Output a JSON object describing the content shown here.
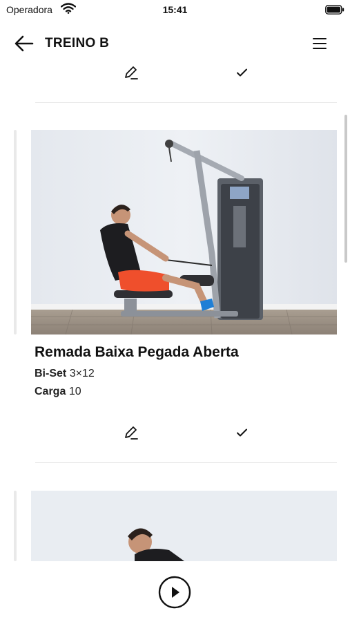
{
  "status_bar": {
    "carrier": "Operadora",
    "time": "15:41"
  },
  "header": {
    "title": "TREINO B",
    "back_icon": "arrow-left-icon",
    "menu_icon": "hamburger-menu-icon"
  },
  "exercises": [
    {
      "name": "Remada Baixa Pegada Aberta",
      "series_label": "Bi-Set",
      "series_value": "3×12",
      "load_label": "Carga",
      "load_value": "10"
    }
  ],
  "icons": {
    "edit": "pencil-icon",
    "done": "check-icon",
    "play": "play-circle-icon"
  },
  "colors": {
    "background": "#ffffff",
    "text": "#111111",
    "divider": "#e6e6e6"
  }
}
